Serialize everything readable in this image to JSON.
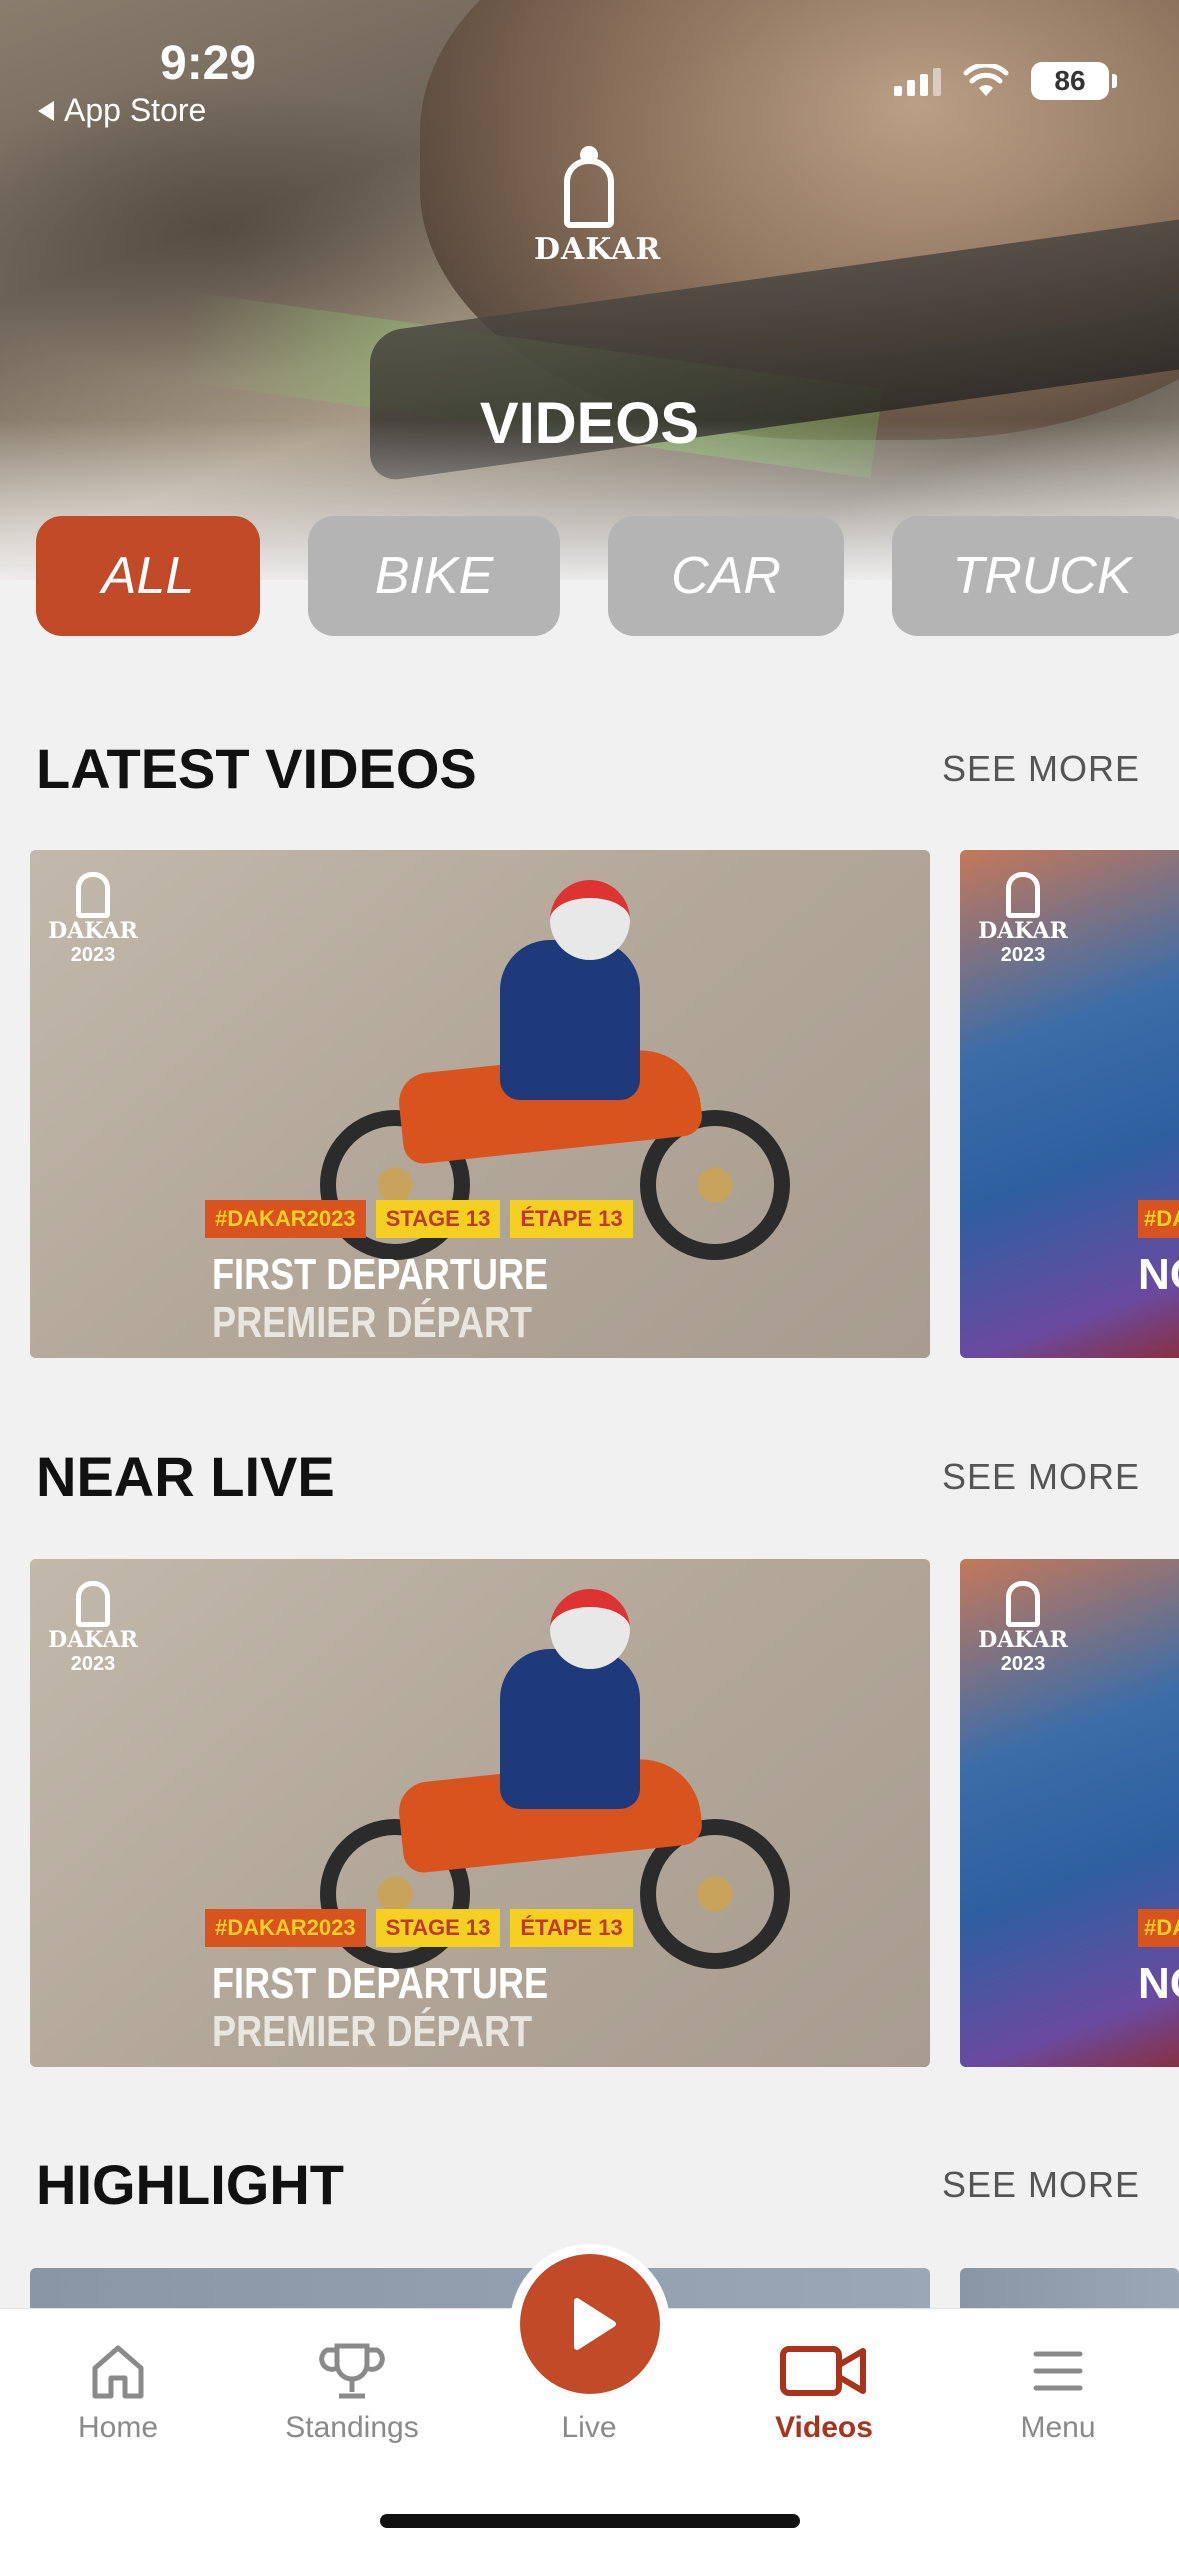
{
  "status_bar": {
    "time": "9:29",
    "back_label": "App Store",
    "battery": "86"
  },
  "header": {
    "logo_text": "DAKAR",
    "title": "VIDEOS"
  },
  "filters": [
    {
      "label": "ALL",
      "active": true
    },
    {
      "label": "BIKE",
      "active": false
    },
    {
      "label": "CAR",
      "active": false
    },
    {
      "label": "TRUCK",
      "active": false
    }
  ],
  "sections": [
    {
      "title": "LATEST VIDEOS",
      "see_more": "SEE MORE",
      "cards": [
        {
          "logo": "DAKAR",
          "year": "2023",
          "tags": [
            "#DAKAR2023",
            "STAGE 13",
            "ÉTAPE 13"
          ],
          "title": "FIRST DEPARTURE",
          "subtitle": "PREMIER DÉPART"
        },
        {
          "logo": "DAKAR",
          "year": "2023",
          "tag_peek": "#DA",
          "title_peek": "NO"
        }
      ]
    },
    {
      "title": "NEAR LIVE",
      "see_more": "SEE MORE",
      "cards": [
        {
          "logo": "DAKAR",
          "year": "2023",
          "tags": [
            "#DAKAR2023",
            "STAGE 13",
            "ÉTAPE 13"
          ],
          "title": "FIRST DEPARTURE",
          "subtitle": "PREMIER DÉPART"
        },
        {
          "logo": "DAKAR",
          "year": "2023",
          "tag_peek": "#DA",
          "title_peek": "NO"
        }
      ]
    },
    {
      "title": "HIGHLIGHT",
      "see_more": "SEE MORE"
    }
  ],
  "bottom_nav": [
    {
      "label": "Home",
      "icon": "home-icon"
    },
    {
      "label": "Standings",
      "icon": "trophy-icon"
    },
    {
      "label": "Live",
      "icon": "play-icon"
    },
    {
      "label": "Videos",
      "icon": "video-camera-icon",
      "active": true
    },
    {
      "label": "Menu",
      "icon": "menu-icon"
    }
  ],
  "colors": {
    "accent": "#c14a28",
    "active_nav": "#a9331d",
    "inactive_tab": "#b4b4b4"
  }
}
